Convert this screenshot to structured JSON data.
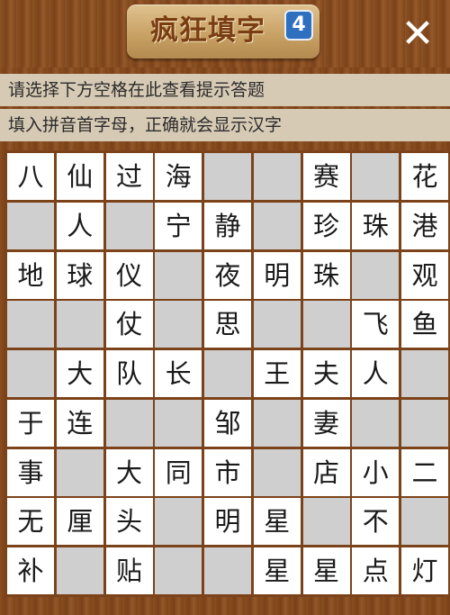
{
  "header": {
    "title": "疯狂填字",
    "level": "4",
    "close_label": "✕"
  },
  "hints": {
    "line1": "请选择下方空格在此查看提示答题",
    "line2": "填入拼音首字母，正确就会显示汉字"
  },
  "grid": {
    "rows": [
      [
        "八",
        "仙",
        "过",
        "海",
        "",
        "",
        "赛",
        "",
        "花"
      ],
      [
        "",
        "人",
        "",
        "宁",
        "静",
        "",
        "珍",
        "珠",
        "港"
      ],
      [
        "地",
        "球",
        "仪",
        "",
        "夜",
        "明",
        "珠",
        "",
        "观"
      ],
      [
        "",
        "",
        "仗",
        "",
        "思",
        "",
        "",
        "飞",
        "鱼"
      ],
      [
        "",
        "大",
        "队",
        "长",
        "",
        "王",
        "夫",
        "人",
        ""
      ],
      [
        "于",
        "连",
        "",
        "",
        "邹",
        "",
        "妻",
        "",
        ""
      ],
      [
        "事",
        "",
        "大",
        "同",
        "市",
        "",
        "店",
        "小",
        "二"
      ],
      [
        "无",
        "厘",
        "头",
        "",
        "明",
        "星",
        "",
        "不",
        ""
      ],
      [
        "补",
        "",
        "贴",
        "",
        "",
        "星",
        "星",
        "点",
        "灯"
      ]
    ],
    "active": [
      [
        1,
        1,
        1,
        1,
        0,
        0,
        1,
        0,
        1
      ],
      [
        0,
        1,
        0,
        1,
        1,
        0,
        1,
        1,
        1
      ],
      [
        1,
        1,
        1,
        0,
        1,
        1,
        1,
        0,
        1
      ],
      [
        0,
        0,
        1,
        0,
        1,
        0,
        0,
        1,
        1
      ],
      [
        0,
        1,
        1,
        1,
        0,
        1,
        1,
        1,
        0
      ],
      [
        1,
        1,
        0,
        0,
        1,
        0,
        1,
        0,
        0
      ],
      [
        1,
        0,
        1,
        1,
        1,
        0,
        1,
        1,
        1
      ],
      [
        1,
        1,
        1,
        0,
        1,
        1,
        0,
        1,
        0
      ],
      [
        1,
        0,
        1,
        0,
        0,
        1,
        1,
        1,
        1
      ]
    ]
  }
}
